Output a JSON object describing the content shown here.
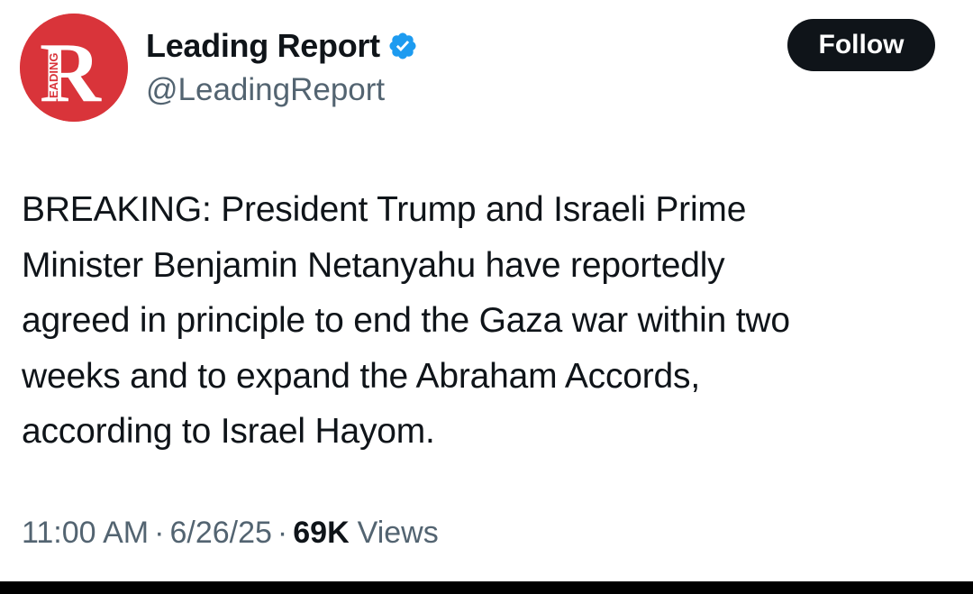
{
  "account": {
    "display_name": "Leading Report",
    "handle": "@LeadingReport",
    "verified_icon": "verified-badge-icon",
    "avatar": {
      "letter": "R",
      "side_text": "LEADING",
      "color": "#d9343a"
    }
  },
  "follow_button": {
    "label": "Follow"
  },
  "tweet": {
    "text_lines": [
      "BREAKING: President Trump and Israeli Prime",
      "Minister Benjamin Netanyahu have reportedly",
      "agreed in principle to end the Gaza war within two",
      "weeks and to expand the Abraham Accords,",
      "according to Israel Hayom."
    ]
  },
  "meta": {
    "time": "11:00 AM",
    "separator": "·",
    "date": "6/26/25",
    "views_count": "69K",
    "views_label": "Views"
  },
  "colors": {
    "accent_blue": "#1d9bf0",
    "text_primary": "#0f1419",
    "text_secondary": "#536471"
  }
}
